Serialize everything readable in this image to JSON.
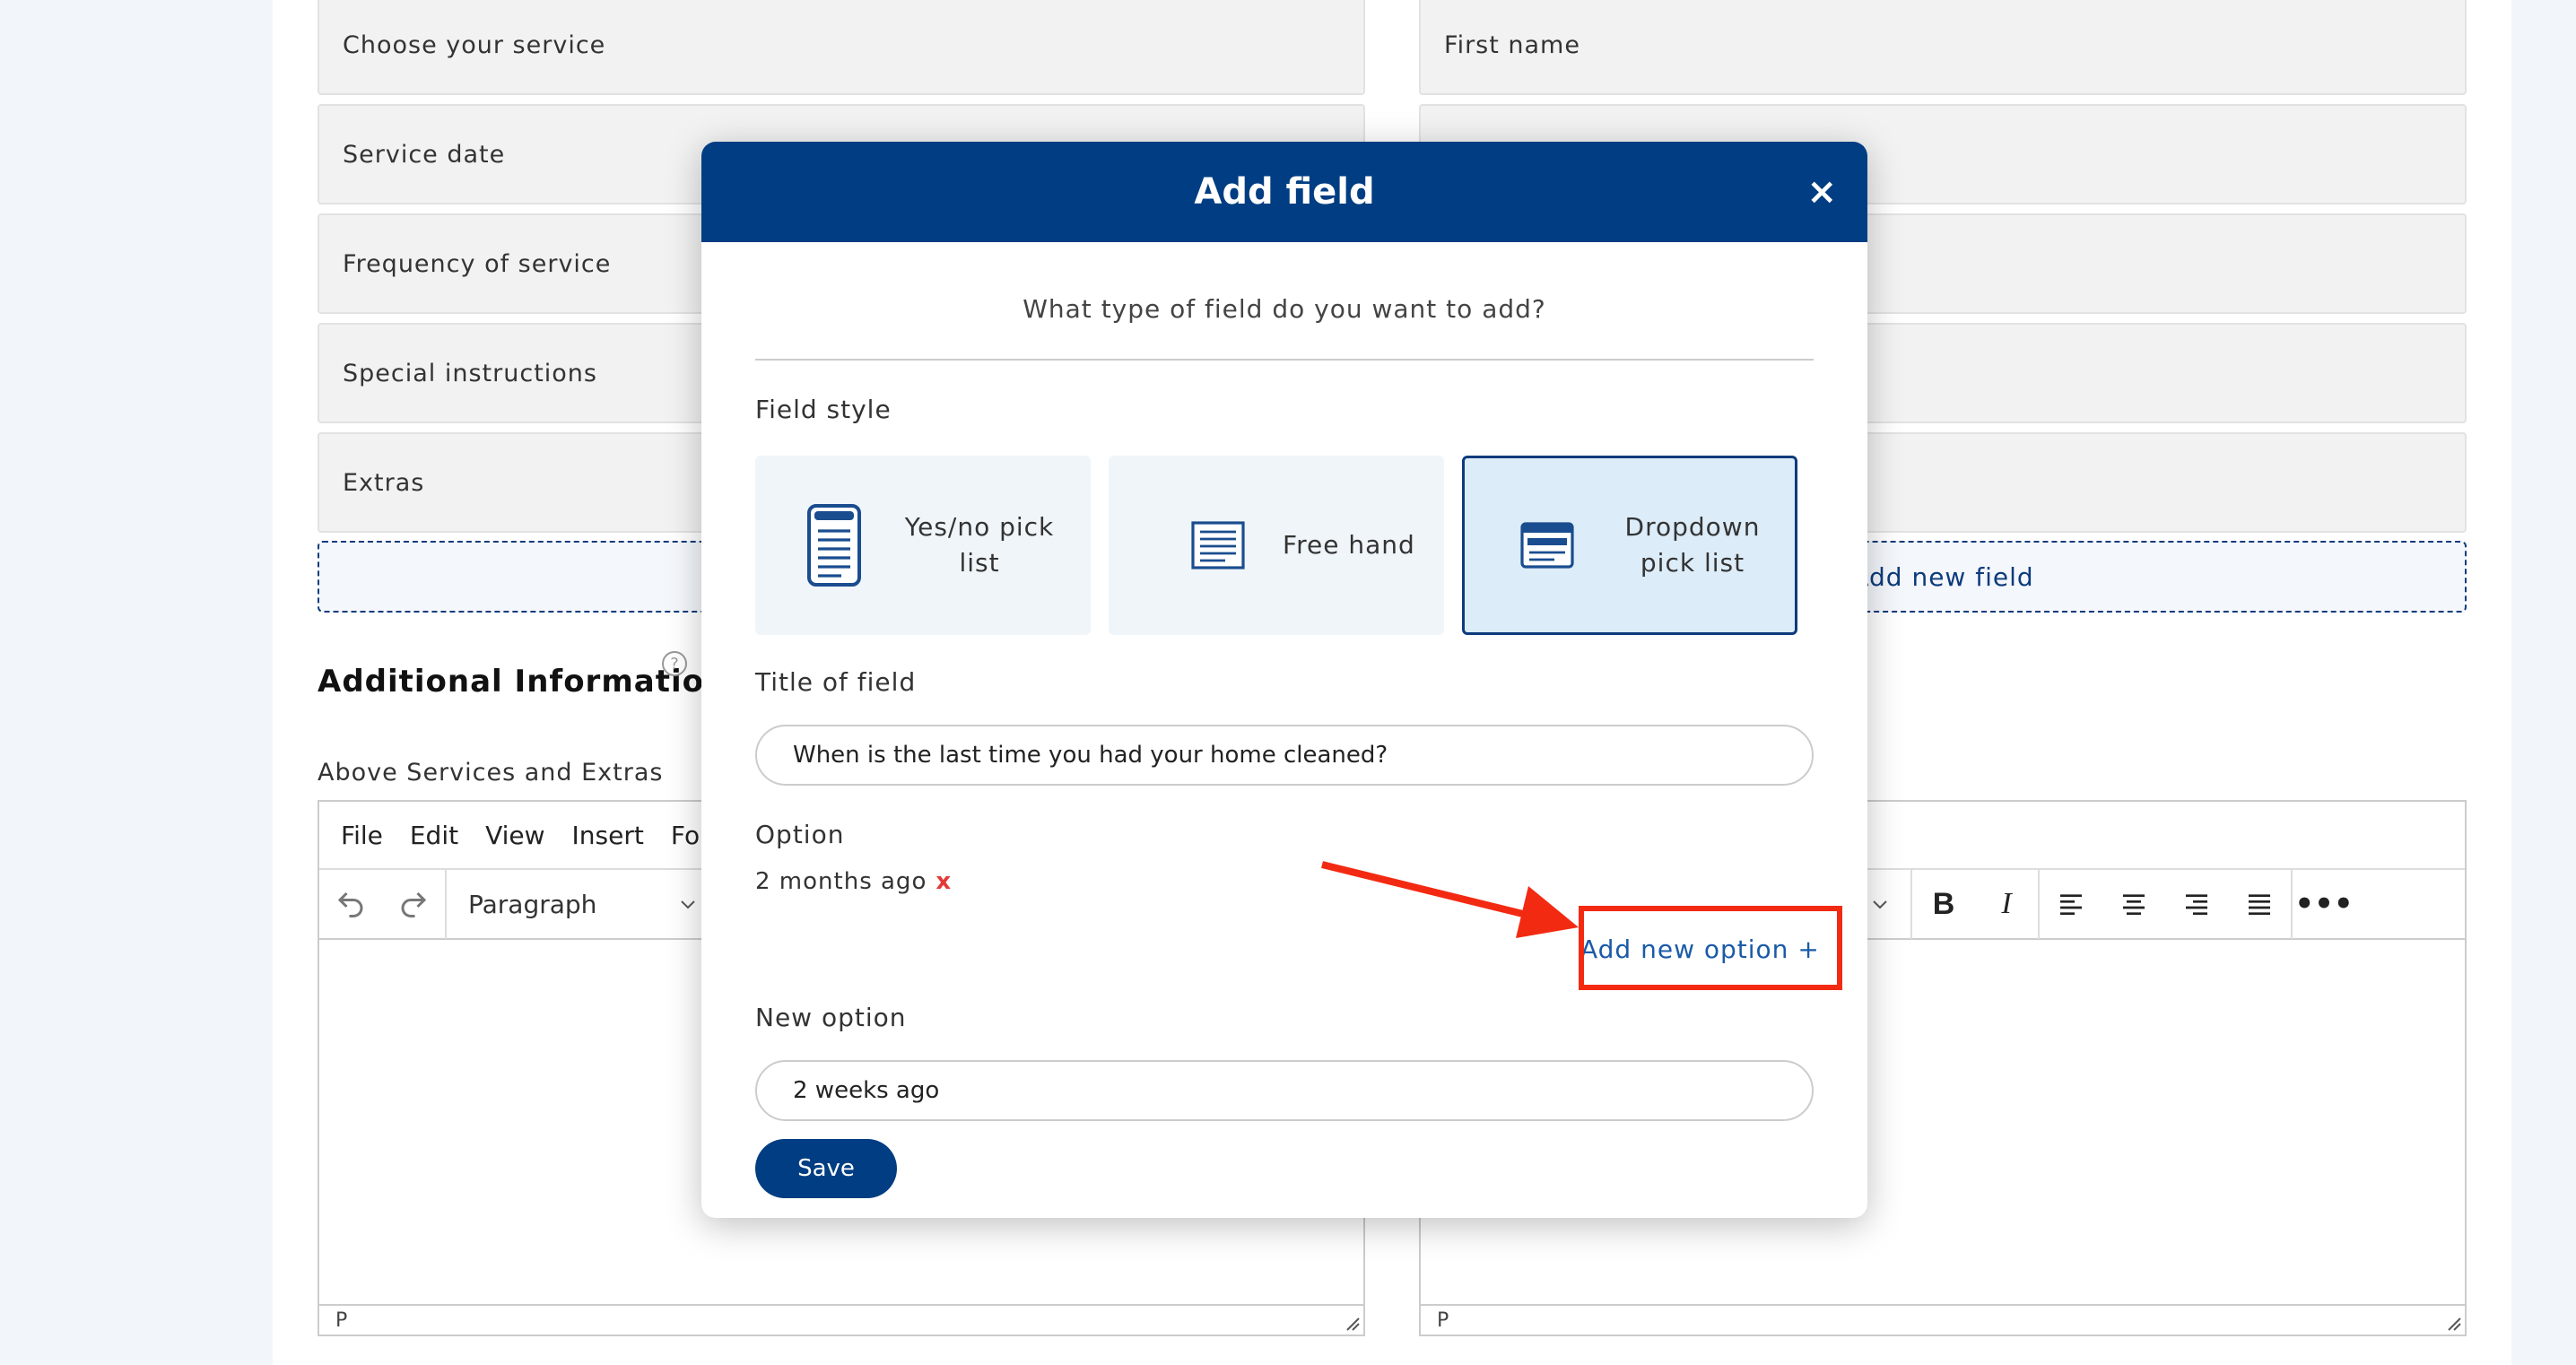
{
  "background_form": {
    "left_fields": [
      "Choose your service",
      "Service date",
      "Frequency of service",
      "Special instructions",
      "Extras"
    ],
    "right_fields": [
      "First name",
      "",
      "",
      "",
      ""
    ],
    "add_new_field_label": "Add new field",
    "additional_info_title": "Additional Information",
    "above_services_label": "Above Services and Extras",
    "editor_menu": [
      "File",
      "Edit",
      "View",
      "Insert",
      "For"
    ],
    "paragraph_label": "Paragraph",
    "status_left": "P",
    "status_right": "P"
  },
  "modal": {
    "title": "Add field",
    "close_icon": "×",
    "question": "What type of field do you want to add?",
    "field_style_label": "Field style",
    "styles": [
      {
        "label": "Yes/no pick list",
        "selected": false
      },
      {
        "label": "Free hand",
        "selected": false
      },
      {
        "label": "Dropdown pick list",
        "selected": true
      }
    ],
    "title_label": "Title of field",
    "title_value": "When is the last time you had your home cleaned?",
    "option_label": "Option",
    "options": [
      "2 months ago"
    ],
    "remove_symbol": "x",
    "add_option_label": "Add new option +",
    "new_option_label": "New option",
    "new_option_value": "2 weeks ago",
    "save_label": "Save"
  },
  "colors": {
    "primary": "#003d82",
    "annotation": "#f32a12",
    "link": "#1a5aa8"
  }
}
